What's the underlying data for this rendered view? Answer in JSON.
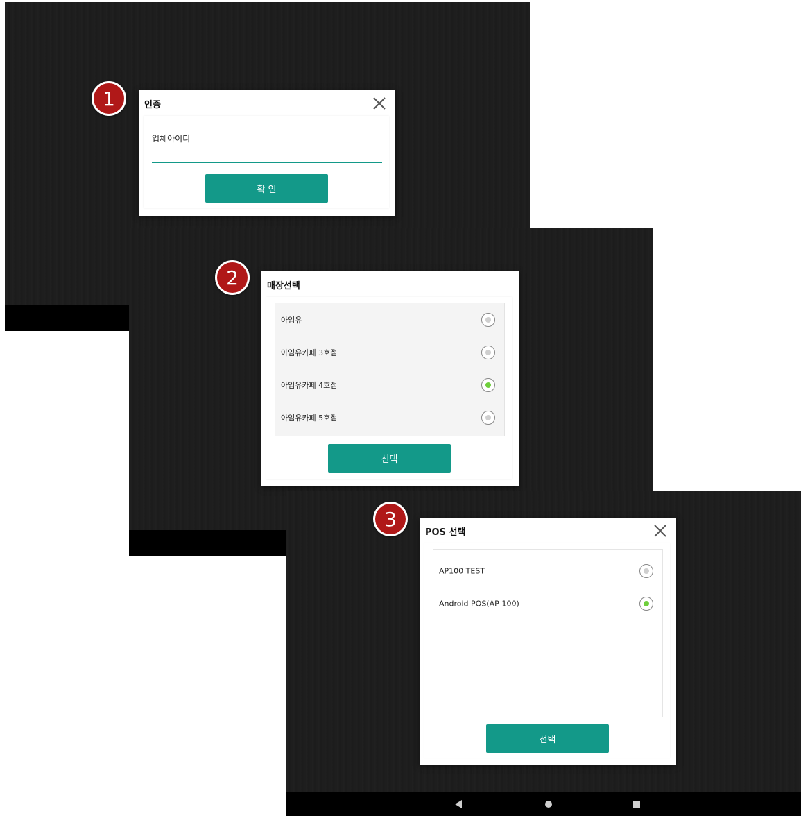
{
  "step_badges": [
    "1",
    "2",
    "3"
  ],
  "auth_dialog": {
    "title": "인증",
    "input_value": "업체아이디",
    "confirm_label": "확 인"
  },
  "store_dialog": {
    "title": "매장선택",
    "options": [
      {
        "label": "아임유",
        "selected": false
      },
      {
        "label": "아임유카페 3호점",
        "selected": false
      },
      {
        "label": "아임유카페 4호점",
        "selected": true
      },
      {
        "label": "아임유카페 5호점",
        "selected": false
      }
    ],
    "select_label": "선택"
  },
  "pos_dialog": {
    "title": "POS 선택",
    "options": [
      {
        "label": "AP100 TEST",
        "selected": false
      },
      {
        "label": "Android POS(AP-100)",
        "selected": true
      }
    ],
    "select_label": "선택"
  },
  "nav_bar": {
    "buttons": [
      "back-icon",
      "home-icon",
      "recents-icon"
    ]
  },
  "colors": {
    "accent": "#139989",
    "badge": "#b01818",
    "radio_selected": "#6fcf3c"
  }
}
